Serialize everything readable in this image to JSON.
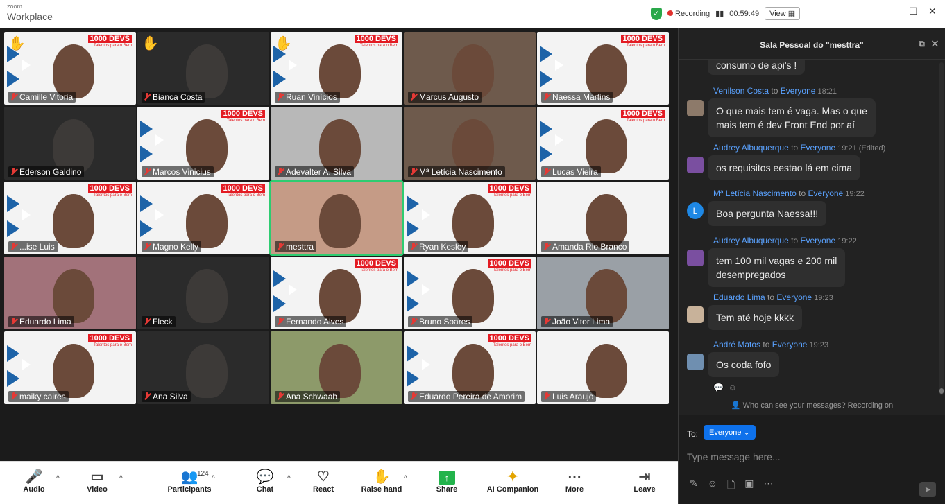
{
  "titlebar": {
    "app_subtitle": "zoom",
    "app_title": "Workplace",
    "recording_label": "Recording",
    "timer": "00:59:49",
    "view_label": "View"
  },
  "gallery": {
    "tiles": [
      {
        "name": "Camille Vitoria",
        "bg": "bg-white",
        "hand": true,
        "logo": true
      },
      {
        "name": "Bianca Costa",
        "bg": "bg-dark",
        "hand": true,
        "logo": false
      },
      {
        "name": "Ruan Vinícios",
        "bg": "bg-white",
        "hand": true,
        "logo": true
      },
      {
        "name": "Marcus Augusto",
        "bg": "bg-brown",
        "hand": false,
        "logo": false
      },
      {
        "name": "Naessa Martins",
        "bg": "bg-white",
        "hand": false,
        "logo": true
      },
      {
        "name": "Ederson Galdino",
        "bg": "bg-dark",
        "hand": false,
        "logo": false
      },
      {
        "name": "Marcos Vinicius",
        "bg": "bg-white",
        "hand": false,
        "logo": true
      },
      {
        "name": "Adevalter A. Silva",
        "bg": "bg-grey",
        "hand": false,
        "logo": false
      },
      {
        "name": "Mª Letícia Nascimento",
        "bg": "bg-brown",
        "hand": false,
        "logo": false
      },
      {
        "name": "Lucas Vieira",
        "bg": "bg-white",
        "hand": false,
        "logo": true
      },
      {
        "name": "...ise Luis",
        "bg": "bg-white",
        "hand": false,
        "logo": true
      },
      {
        "name": "Magno Kelly",
        "bg": "bg-white",
        "hand": false,
        "logo": true
      },
      {
        "name": "mesttra",
        "bg": "bg-warm",
        "hand": false,
        "logo": false
      },
      {
        "name": "Ryan Kesley",
        "bg": "bg-white",
        "hand": false,
        "logo": true
      },
      {
        "name": "Amanda Rio Branco",
        "bg": "bg-white",
        "hand": false,
        "logo": false
      },
      {
        "name": "Eduardo Lima",
        "bg": "bg-pink",
        "hand": false,
        "logo": false
      },
      {
        "name": "Fleck",
        "bg": "bg-dark",
        "hand": false,
        "logo": false
      },
      {
        "name": "Fernando Alves",
        "bg": "bg-white",
        "hand": false,
        "logo": true
      },
      {
        "name": "Bruno Soares",
        "bg": "bg-white",
        "hand": false,
        "logo": true
      },
      {
        "name": "João Vitor Lima",
        "bg": "bg-office",
        "hand": false,
        "logo": false
      },
      {
        "name": "maiky caires",
        "bg": "bg-white",
        "hand": false,
        "logo": true
      },
      {
        "name": "Ana Silva",
        "bg": "bg-dark",
        "hand": false,
        "logo": false
      },
      {
        "name": "Ana Schwaab",
        "bg": "bg-green",
        "hand": false,
        "logo": false
      },
      {
        "name": "Eduardo Pereira de Amorim",
        "bg": "bg-white",
        "hand": false,
        "logo": true
      },
      {
        "name": "Luis Araujo",
        "bg": "bg-white",
        "hand": false,
        "logo": false
      }
    ],
    "logo_text": "1000 DEVS",
    "logo_sub": "Talentos para o Bem"
  },
  "toolbar": {
    "audio": "Audio",
    "video": "Video",
    "participants": "Participants",
    "participants_count": "124",
    "chat": "Chat",
    "react": "React",
    "raise_hand": "Raise hand",
    "share": "Share",
    "ai_companion": "AI Companion",
    "more": "More",
    "leave": "Leave"
  },
  "chat": {
    "title": "Sala Pessoal do \"mesttra\"",
    "first_bubble": "consumo de api's !",
    "to_word": "to",
    "everyone": "Everyone",
    "messages": [
      {
        "sender": "Venilson Costa",
        "time": "18:21",
        "text_lines": [
          "O que mais tem é vaga. Mas o que",
          "mais tem é dev Front End por aí"
        ],
        "avatar": "photo"
      },
      {
        "sender": "Audrey Albuquerque",
        "time": "19:21 (Edited)",
        "text_lines": [
          "os requisitos eestao lá em cima"
        ],
        "avatar": "photo"
      },
      {
        "sender": "Mª Letícia Nascimento",
        "time": "19:22",
        "text_lines": [
          "Boa pergunta Naessa!!!"
        ],
        "avatar": "L"
      },
      {
        "sender": "Audrey Albuquerque",
        "time": "19:22",
        "text_lines": [
          "tem 100 mil vagas e 200 mil",
          "desempregados"
        ],
        "avatar": "photo"
      },
      {
        "sender": "Eduardo Lima",
        "time": "19:23",
        "text_lines": [
          "Tem até hoje kkkk"
        ],
        "avatar": "photo"
      },
      {
        "sender": "André Matos",
        "time": "19:23",
        "text_lines": [
          "Os coda fofo"
        ],
        "avatar": "photo"
      }
    ],
    "privacy_note": "Who can see your messages? Recording on",
    "to_label": "To:",
    "recipient": "Everyone",
    "input_placeholder": "Type message here..."
  }
}
